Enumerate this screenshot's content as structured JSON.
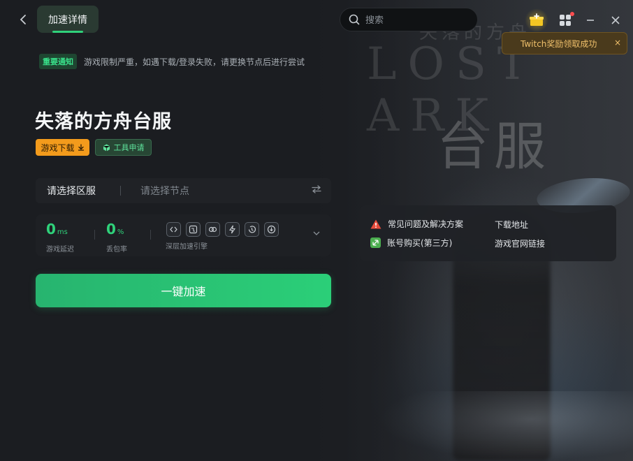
{
  "header": {
    "tab_label": "加速详情",
    "search_placeholder": "搜索"
  },
  "toast": {
    "message": "Twitch奖励领取成功",
    "close_glyph": "×"
  },
  "notice": {
    "tag": "重要通知",
    "text": "游戏限制严重，如遇下载/登录失败，请更换节点后进行尝试"
  },
  "game": {
    "title": "失落的方舟台服",
    "download_label": "游戏下载",
    "tool_label": "工具申请"
  },
  "selector": {
    "region_label": "请选择区服",
    "node_placeholder": "请选择节点"
  },
  "stats": {
    "latency_value": "0",
    "latency_unit": "ms",
    "latency_label": "游戏延迟",
    "loss_value": "0",
    "loss_unit": "%",
    "loss_label": "丢包率",
    "engine_label": "深层加速引擎"
  },
  "accelerate_label": "一键加速",
  "help": {
    "faq": "常见问题及解决方案",
    "download_link": "下载地址",
    "account": "账号购买(第三方)",
    "official_link": "游戏官网链接"
  },
  "background": {
    "watermark_top": "失落的方舟",
    "logo_text": "LOST ARK",
    "region_text": "台服"
  },
  "colors": {
    "accent_green": "#2fd17a",
    "download_orange": "#f39b1c",
    "toast_text": "#f0c06b",
    "warning_red": "#e74c3c"
  }
}
